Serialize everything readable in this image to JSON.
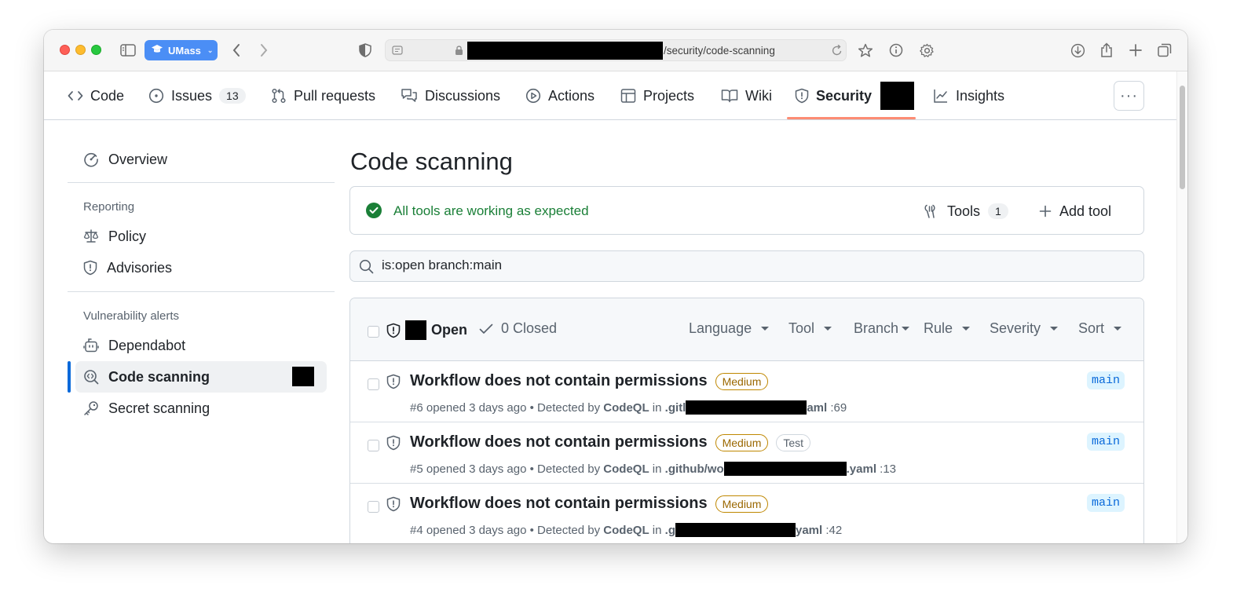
{
  "browser": {
    "profile": "UMass",
    "url_suffix": "/security/code-scanning"
  },
  "repo_nav": {
    "items": [
      {
        "label": "Code"
      },
      {
        "label": "Issues",
        "count": "13"
      },
      {
        "label": "Pull requests"
      },
      {
        "label": "Discussions"
      },
      {
        "label": "Actions"
      },
      {
        "label": "Projects"
      },
      {
        "label": "Wiki"
      },
      {
        "label": "Security"
      },
      {
        "label": "Insights"
      }
    ],
    "more_glyph": "···"
  },
  "sidebar": {
    "overview": "Overview",
    "reporting_heading": "Reporting",
    "policy": "Policy",
    "advisories": "Advisories",
    "vuln_heading": "Vulnerability alerts",
    "dependabot": "Dependabot",
    "code_scanning": "Code scanning",
    "secret_scanning": "Secret scanning"
  },
  "main": {
    "title": "Code scanning",
    "status": "All tools are working as expected",
    "tools_label": "Tools",
    "tools_count": "1",
    "add_tool": "Add tool",
    "search_value": "is:open branch:main"
  },
  "list_header": {
    "open_label": "Open",
    "closed_label": "0 Closed",
    "filters": [
      "Language",
      "Tool",
      "Branch",
      "Rule",
      "Severity",
      "Sort"
    ]
  },
  "alerts": [
    {
      "title": "Workflow does not contain permissions",
      "severity": "Medium",
      "tag": "",
      "meta_prefix": "#6 opened 3 days ago • Detected by",
      "tool": "CodeQL",
      "in_word": "in",
      "path_start": ".gitl",
      "path_end": "aml",
      "line": ":69",
      "branch": "main"
    },
    {
      "title": "Workflow does not contain permissions",
      "severity": "Medium",
      "tag": "Test",
      "meta_prefix": "#5 opened 3 days ago • Detected by",
      "tool": "CodeQL",
      "in_word": "in",
      "path_start": ".github/wo",
      "path_end": ".yaml",
      "line": ":13",
      "branch": "main"
    },
    {
      "title": "Workflow does not contain permissions",
      "severity": "Medium",
      "tag": "",
      "meta_prefix": "#4 opened 3 days ago • Detected by",
      "tool": "CodeQL",
      "in_word": "in",
      "path_start": ".g",
      "path_end": "yaml",
      "line": ":42",
      "branch": "main"
    }
  ]
}
